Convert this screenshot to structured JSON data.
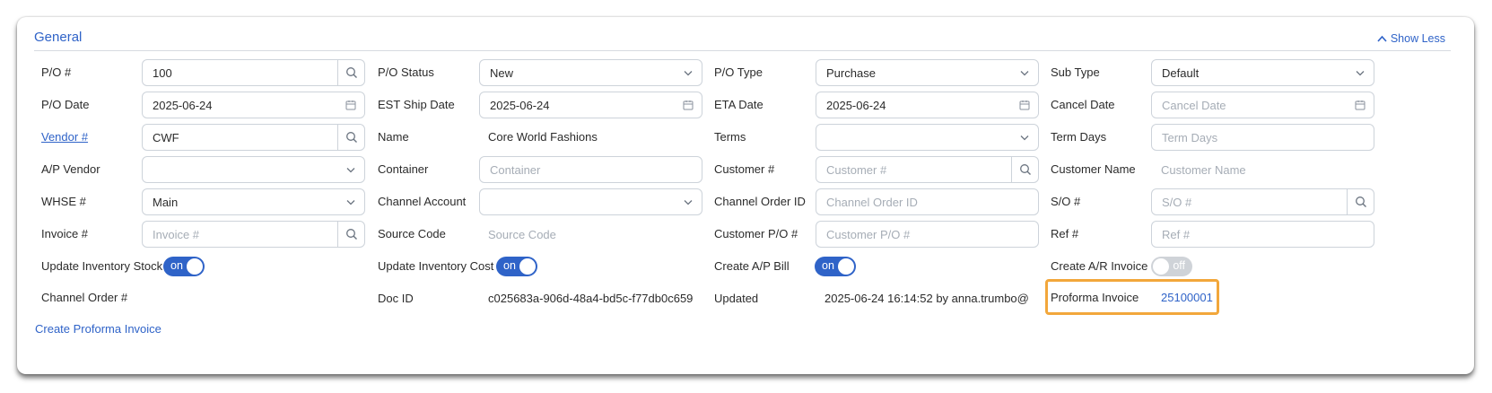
{
  "section": {
    "title": "General",
    "show_less": "Show Less"
  },
  "row1": {
    "po_label": "P/O #",
    "po_value": "100",
    "status_label": "P/O Status",
    "status_value": "New",
    "type_label": "P/O Type",
    "type_value": "Purchase",
    "subtype_label": "Sub Type",
    "subtype_value": "Default"
  },
  "row2": {
    "po_date_label": "P/O Date",
    "po_date_value": "2025-06-24",
    "est_ship_label": "EST Ship Date",
    "est_ship_value": "2025-06-24",
    "eta_label": "ETA Date",
    "eta_value": "2025-06-24",
    "cancel_label": "Cancel Date",
    "cancel_placeholder": "Cancel Date"
  },
  "row3": {
    "vendor_label": "Vendor #",
    "vendor_value": "CWF",
    "name_label": "Name",
    "name_value": "Core World Fashions",
    "terms_label": "Terms",
    "terms_value": "",
    "term_days_label": "Term Days",
    "term_days_placeholder": "Term Days"
  },
  "row4": {
    "ap_vendor_label": "A/P Vendor",
    "ap_vendor_value": "",
    "container_label": "Container",
    "container_placeholder": "Container",
    "customer_label": "Customer #",
    "customer_placeholder": "Customer #",
    "customer_name_label": "Customer Name",
    "customer_name_placeholder": "Customer Name"
  },
  "row5": {
    "whse_label": "WHSE #",
    "whse_value": "Main",
    "channel_account_label": "Channel Account",
    "channel_account_value": "",
    "channel_order_id_label": "Channel Order ID",
    "channel_order_id_placeholder": "Channel Order ID",
    "so_label": "S/O #",
    "so_placeholder": "S/O #"
  },
  "row6": {
    "invoice_label": "Invoice #",
    "invoice_placeholder": "Invoice #",
    "source_code_label": "Source Code",
    "source_code_placeholder": "Source Code",
    "customer_po_label": "Customer P/O #",
    "customer_po_placeholder": "Customer P/O #",
    "ref_label": "Ref #",
    "ref_placeholder": "Ref #"
  },
  "row7": {
    "update_stock_label": "Update Inventory Stock",
    "update_stock_state": "on",
    "update_cost_label": "Update Inventory Cost",
    "update_cost_state": "on",
    "create_ap_label": "Create A/P Bill",
    "create_ap_state": "on",
    "create_ar_label": "Create A/R Invoice",
    "create_ar_state": "off"
  },
  "row8": {
    "channel_order_label": "Channel Order #",
    "doc_id_label": "Doc ID",
    "doc_id_value": "c025683a-906d-48a4-bd5c-f77db0c659",
    "updated_label": "Updated",
    "updated_value": "2025-06-24 16:14:52 by anna.trumbo@",
    "proforma_label": "Proforma Invoice",
    "proforma_value": "25100001"
  },
  "actions": {
    "create_proforma": "Create Proforma Invoice"
  },
  "colors": {
    "accent": "#2f63c8",
    "highlight": "#f2a73b",
    "toggle_off": "#cfd3d8"
  },
  "icons": [
    "search-icon",
    "chevron-down-icon",
    "calendar-icon",
    "chevron-up-icon"
  ]
}
